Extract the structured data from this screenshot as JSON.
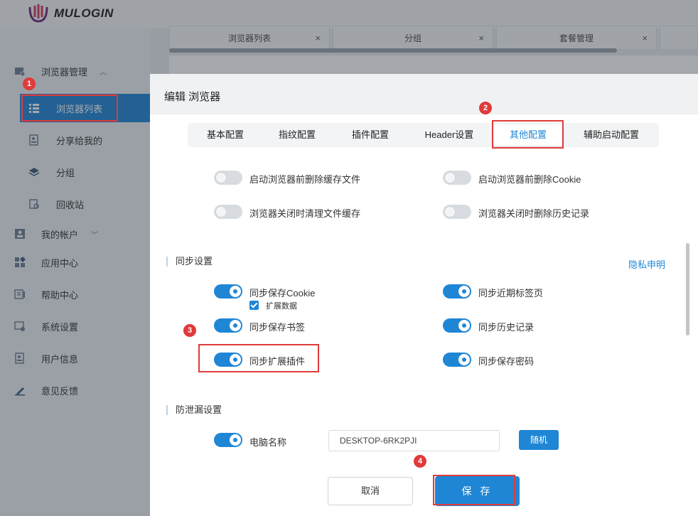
{
  "app": {
    "logo_text": "MULOGIN",
    "brand_color": "#1f86d6"
  },
  "sidebar": {
    "items": [
      {
        "label": "浏览器管理",
        "icon": "browser-manage-icon"
      },
      {
        "label": "浏览器列表",
        "icon": "list-icon",
        "active": true
      },
      {
        "label": "分享给我的",
        "icon": "share-icon"
      },
      {
        "label": "分组",
        "icon": "layers-icon"
      },
      {
        "label": "回收站",
        "icon": "recycle-icon"
      },
      {
        "label": "我的帐户",
        "icon": "account-icon"
      },
      {
        "label": "应用中心",
        "icon": "apps-icon"
      },
      {
        "label": "帮助中心",
        "icon": "help-icon"
      },
      {
        "label": "系统设置",
        "icon": "settings-icon"
      },
      {
        "label": "用户信息",
        "icon": "user-info-icon"
      },
      {
        "label": "意见反馈",
        "icon": "feedback-icon"
      }
    ]
  },
  "page_tabs": [
    {
      "label": "浏览器列表",
      "close": "×"
    },
    {
      "label": "分组",
      "close": "×"
    },
    {
      "label": "套餐管理",
      "close": "×"
    }
  ],
  "modal": {
    "title": "编辑 浏览器",
    "tabs": [
      "基本配置",
      "指纹配置",
      "插件配置",
      "Header设置",
      "其他配置",
      "辅助启动配置"
    ],
    "active_tab": "其他配置",
    "cache_options": [
      {
        "label": "启动浏览器前删除缓存文件",
        "on": false
      },
      {
        "label": "启动浏览器前删除Cookie",
        "on": false
      },
      {
        "label": "浏览器关闭时清理文件缓存",
        "on": false
      },
      {
        "label": "浏览器关闭时删除历史记录",
        "on": false
      }
    ],
    "sync": {
      "title": "同步设置",
      "privacy_link": "隐私申明",
      "options": [
        {
          "label": "同步保存Cookie",
          "on": true
        },
        {
          "label": "同步近期标签页",
          "on": true
        },
        {
          "label": "同步保存书签",
          "on": true
        },
        {
          "label": "同步历史记录",
          "on": true
        },
        {
          "label": "同步扩展插件",
          "on": true
        },
        {
          "label": "同步保存密码",
          "on": true
        }
      ],
      "extend_data_label": "扩展数据",
      "extend_data_checked": true
    },
    "leak": {
      "title": "防泄漏设置",
      "computer_name_label": "电脑名称",
      "computer_name_on": true,
      "computer_name_value": "DESKTOP-6RK2PJI",
      "random_button": "随机"
    },
    "buttons": {
      "cancel": "取消",
      "save": "保 存"
    }
  },
  "annotations": {
    "color": "#e03a3a",
    "badges": [
      "1",
      "2",
      "3",
      "4"
    ]
  }
}
